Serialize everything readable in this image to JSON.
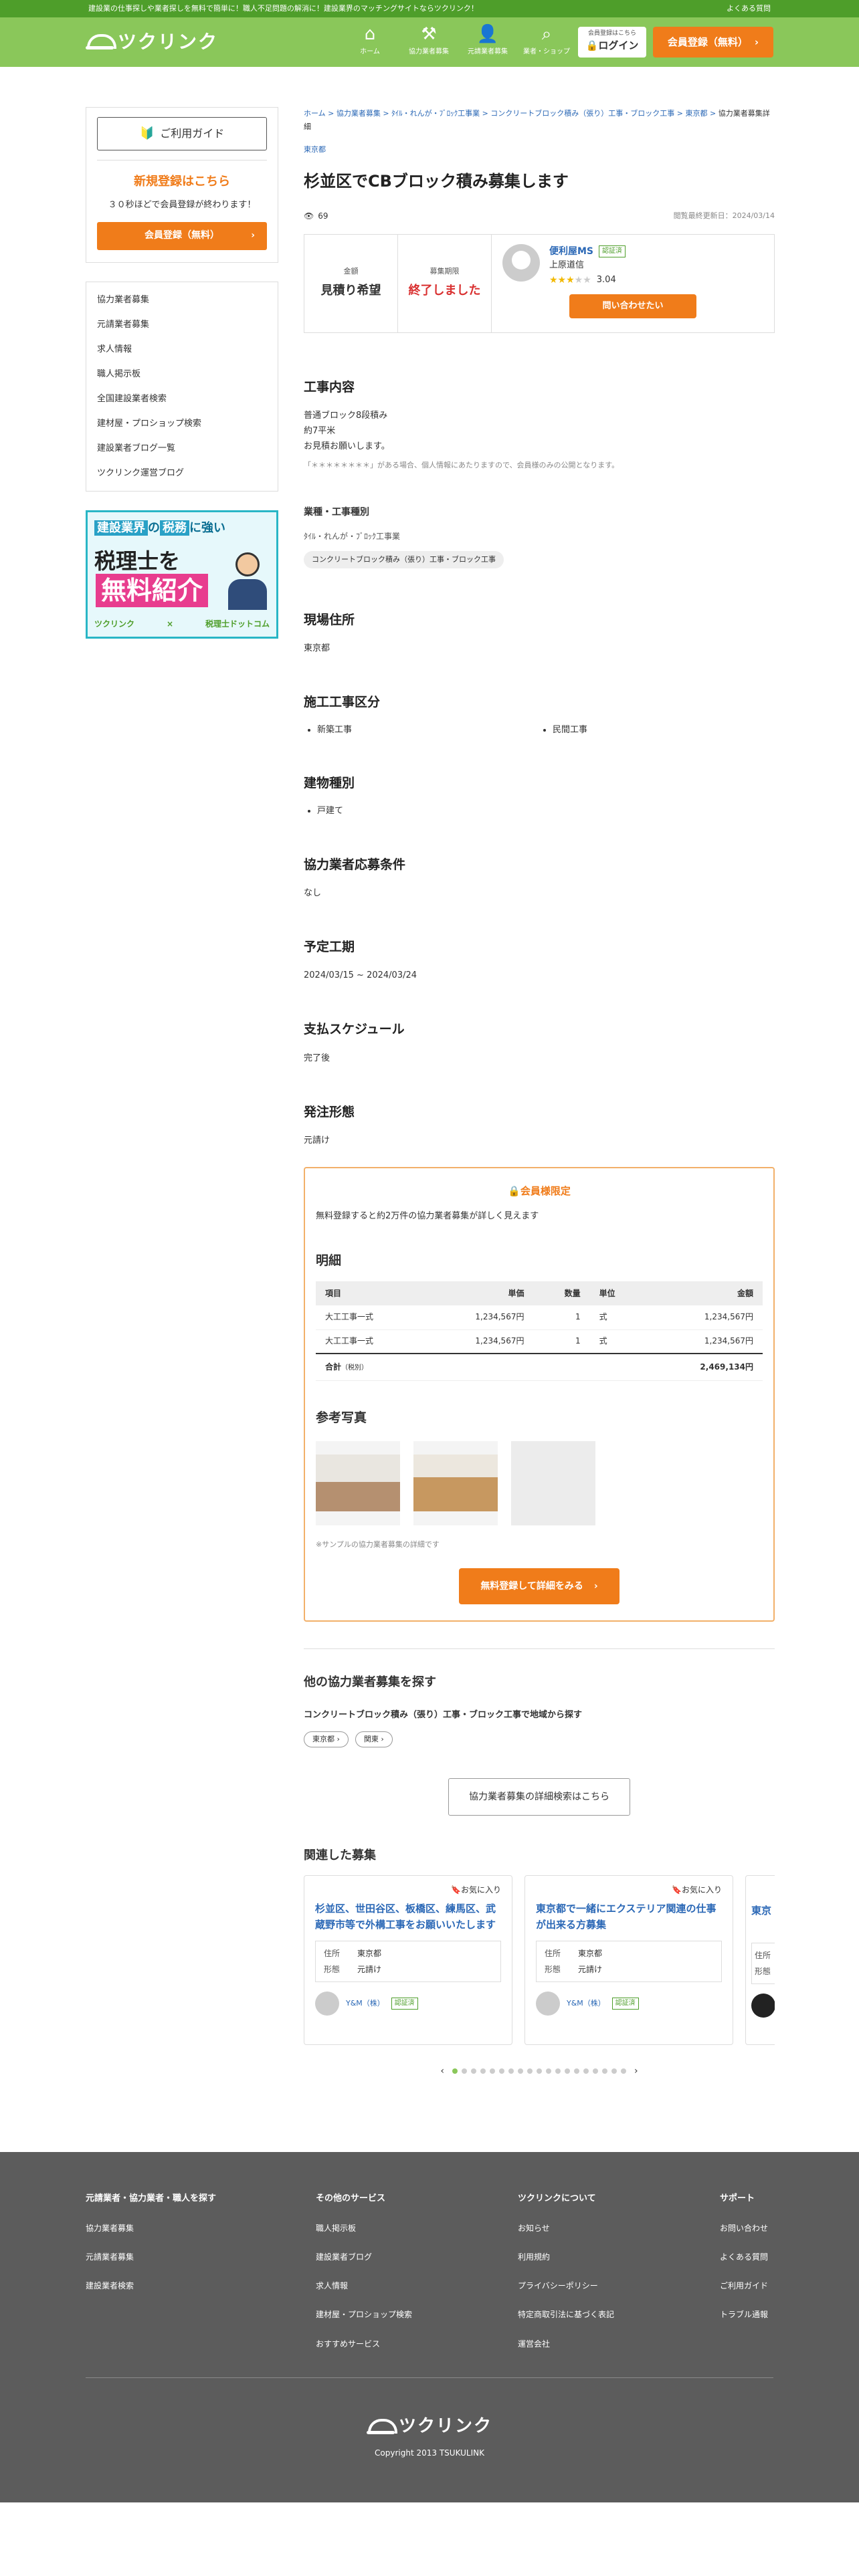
{
  "topbar": {
    "message": "建設業の仕事探しや業者探しを無料で簡単に！職人不足問題の解消に！建設業界のマッチングサイトならツクリンク！",
    "faq": "よくある質問"
  },
  "header": {
    "logo": "ツクリンク",
    "nav": [
      {
        "label": "ホーム",
        "icon": "home-icon"
      },
      {
        "label": "協力業者募集",
        "icon": "hammer-icon"
      },
      {
        "label": "元請業者募集",
        "icon": "worker-icon"
      },
      {
        "label": "業者・ショップ",
        "icon": "search-icon"
      }
    ],
    "login_small": "会員登録はこちら",
    "login": "ログイン",
    "signup": "会員登録（無料）"
  },
  "sidebar": {
    "guide": "ご利用ガイド",
    "reg_title": "新規登録はこちら",
    "reg_sub": "３０秒ほどで会員登録が終わります！",
    "reg_btn": "会員登録（無料）",
    "links": [
      "協力業者募集",
      "元請業者募集",
      "求人情報",
      "職人掲示板",
      "全国建設業者検索",
      "建材屋・プロショップ検索",
      "建設業者ブログ一覧",
      "ツクリンク運営ブログ"
    ],
    "banner": {
      "line1a": "建設業界",
      "line1b": "の",
      "line1c": "税務",
      "line1d": "に強い",
      "line2": "税理士を",
      "line3": "無料紹介",
      "brand1": "ツクリンク",
      "x": "×",
      "brand2": "税理士ドットコム"
    }
  },
  "breadcrumb": {
    "text": "ホーム > 協力業者募集 > ﾀｲﾙ・れんが・ﾌﾞﾛｯｸ工事業 > コンクリートブロック積み（張り）工事・ブロック工事 > 東京都 > ",
    "current": "協力業者募集詳細",
    "pref": "東京都"
  },
  "title": "杉並区でCBブロック積み募集します",
  "views": "69",
  "updated": "閲覧最終更新日：2024/03/14",
  "summary": {
    "amount_label": "金額",
    "amount": "見積り希望",
    "period_label": "募集期限",
    "period": "終了しました",
    "company": "便利屋MS",
    "badge": "認証済",
    "company_sub": "上原道信",
    "rating": "3.04",
    "inquiry": "問い合わせたい"
  },
  "work": {
    "heading": "工事内容",
    "line1": "普通ブロック8段積み",
    "line2": "約7平米",
    "line3": "お見積お願いします。",
    "note": "「＊＊＊＊＊＊＊＊」がある場合、個人情報にあたりますので、会員様のみの公開となります。"
  },
  "category": {
    "heading": "業種・工事種別",
    "line": "ﾀｲﾙ・れんが・ﾌﾞﾛｯｸ工事業",
    "tag": "コンクリートブロック積み（張り）工事・ブロック工事"
  },
  "address": {
    "heading": "現場住所",
    "value": "東京都"
  },
  "construction": {
    "heading": "施工工事区分",
    "items": [
      "新築工事",
      "民間工事"
    ]
  },
  "building": {
    "heading": "建物種別",
    "items": [
      "戸建て"
    ]
  },
  "conditions": {
    "heading": "協力業者応募条件",
    "value": "なし"
  },
  "schedule": {
    "heading": "予定工期",
    "value": "2024/03/15 ~ 2024/03/24"
  },
  "payment": {
    "heading": "支払スケジュール",
    "value": "完了後"
  },
  "order": {
    "heading": "発注形態",
    "value": "元請け"
  },
  "members": {
    "lock": "会員様限定",
    "intro": "無料登録すると約2万件の協力業者募集が詳しく見えます",
    "detail_heading": "明細",
    "cols": [
      "項目",
      "単価",
      "数量",
      "単位",
      "金額"
    ],
    "rows": [
      [
        "大工工事一式",
        "1,234,567円",
        "1",
        "式",
        "1,234,567円"
      ],
      [
        "大工工事一式",
        "1,234,567円",
        "1",
        "式",
        "1,234,567円"
      ]
    ],
    "total_label": "合計",
    "total_small": "（税別）",
    "total": "2,469,134円",
    "photos_heading": "参考写真",
    "sample": "※サンプルの協力業者募集の詳細です",
    "btn": "無料登録して詳細をみる"
  },
  "search": {
    "heading": "他の協力業者募集を探す",
    "sub": "コンクリートブロック積み（張り）工事・ブロック工事で地域から探す",
    "pills": [
      "東京都 ›",
      "関東 ›"
    ],
    "adv": "協力業者募集の詳細検索はこちら"
  },
  "related": {
    "heading": "関連した募集",
    "fav": "お気に入り",
    "cards": [
      {
        "title": "杉並区、世田谷区、板橋区、練馬区、武蔵野市等で外構工事をお願いいたします",
        "addr_k": "住所",
        "addr": "東京都",
        "type_k": "形態",
        "type": "元請け",
        "author": "Y&M（株）",
        "badge": "認証済"
      },
      {
        "title": "東京都で一緒にエクステリア関連の仕事が出来る方募集",
        "addr_k": "住所",
        "addr": "東京都",
        "type_k": "形態",
        "type": "元請け",
        "author": "Y&M（株）",
        "badge": "認証済"
      }
    ],
    "partial_title": "東京",
    "partial_k1": "住所",
    "partial_k2": "形態",
    "prev": "‹",
    "next": "›"
  },
  "footer": {
    "cols": [
      {
        "title": "元請業者・協力業者・職人を探す",
        "items": [
          "協力業者募集",
          "元請業者募集",
          "建設業者検索"
        ]
      },
      {
        "title": "その他のサービス",
        "items": [
          "職人掲示板",
          "建設業者ブログ",
          "求人情報",
          "建材屋・プロショップ検索",
          "おすすめサービス"
        ]
      },
      {
        "title": "ツクリンクについて",
        "items": [
          "お知らせ",
          "利用規約",
          "プライバシーポリシー",
          "特定商取引法に基づく表記",
          "運営会社"
        ]
      },
      {
        "title": "サポート",
        "items": [
          "お問い合わせ",
          "よくある質問",
          "ご利用ガイド",
          "トラブル通報"
        ]
      }
    ],
    "logo": "ツクリンク",
    "copy": "Copyright 2013 TSUKULINK"
  },
  "colors": {
    "brand_green": "#8ac75a",
    "accent_orange": "#f07c1a",
    "link_blue": "#2b68b6"
  }
}
